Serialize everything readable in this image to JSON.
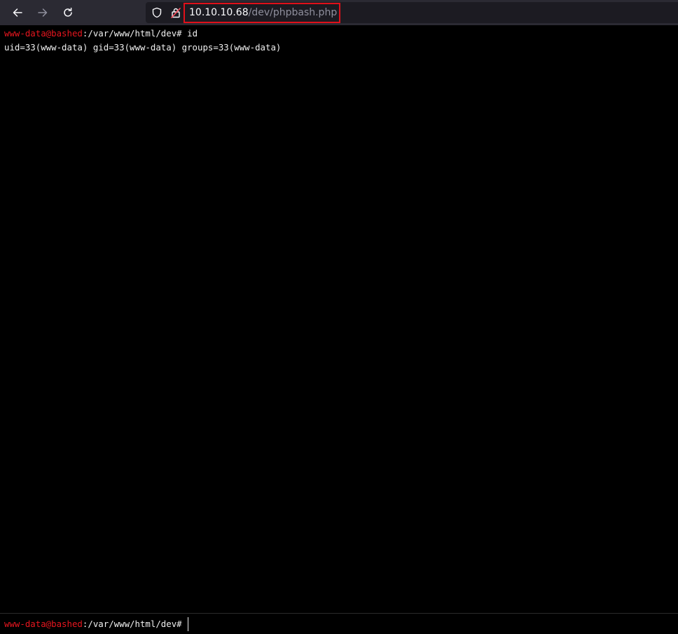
{
  "browser": {
    "nav": {
      "back_icon": "arrow-left-icon",
      "forward_icon": "arrow-right-icon",
      "reload_icon": "reload-icon"
    },
    "url": {
      "host": "10.10.10.68",
      "path": "/dev/phpbash.php",
      "highlight_color": "#e0101a"
    }
  },
  "terminal": {
    "prompt_colors": {
      "user_host": "#e8161f",
      "text": "#f0f0f0"
    },
    "history": [
      {
        "user_host": "www-data@bashed",
        "path": ":/var/www/html/dev#",
        "command": "id"
      }
    ],
    "output": [
      "uid=33(www-data) gid=33(www-data) groups=33(www-data)"
    ],
    "input_prompt": {
      "user_host": "www-data@bashed",
      "path": ":/var/www/html/dev#"
    },
    "input_value": ""
  }
}
